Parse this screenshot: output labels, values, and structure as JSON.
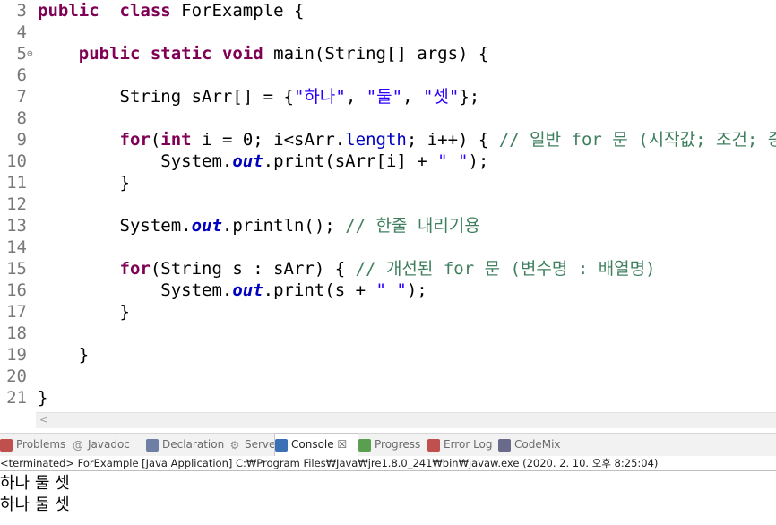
{
  "editor": {
    "lines": [
      {
        "n": "3",
        "parts": [
          [
            "kw",
            "public"
          ],
          [
            "",
            "  "
          ],
          [
            "kw",
            "class"
          ],
          [
            "",
            " ForExample {"
          ]
        ]
      },
      {
        "n": "4",
        "parts": []
      },
      {
        "n": "5",
        "fold": true,
        "parts": [
          [
            "",
            "    "
          ],
          [
            "kw",
            "public"
          ],
          [
            "",
            " "
          ],
          [
            "kw",
            "static"
          ],
          [
            "",
            " "
          ],
          [
            "kw",
            "void"
          ],
          [
            "",
            " main(String[] args) {"
          ]
        ]
      },
      {
        "n": "6",
        "parts": []
      },
      {
        "n": "7",
        "parts": [
          [
            "",
            "        String sArr[] = {"
          ],
          [
            "str",
            "\"하나\""
          ],
          [
            "",
            ", "
          ],
          [
            "str",
            "\"둘\""
          ],
          [
            "",
            ", "
          ],
          [
            "str",
            "\"셋\""
          ],
          [
            "",
            "};"
          ]
        ]
      },
      {
        "n": "8",
        "parts": []
      },
      {
        "n": "9",
        "parts": [
          [
            "",
            "        "
          ],
          [
            "kw",
            "for"
          ],
          [
            "",
            "("
          ],
          [
            "kw",
            "int"
          ],
          [
            "",
            " i = 0; i<sArr."
          ],
          [
            "fld",
            "length"
          ],
          [
            "",
            "; i++) { "
          ],
          [
            "cm",
            "// 일반 for 문 (시작값; 조건; 증감;)"
          ]
        ]
      },
      {
        "n": "10",
        "parts": [
          [
            "",
            "            System."
          ],
          [
            "sfld",
            "out"
          ],
          [
            "",
            ".print(sArr[i] + "
          ],
          [
            "str",
            "\" \""
          ],
          [
            "",
            ");"
          ]
        ]
      },
      {
        "n": "11",
        "parts": [
          [
            "",
            "        }"
          ]
        ]
      },
      {
        "n": "12",
        "parts": []
      },
      {
        "n": "13",
        "parts": [
          [
            "",
            "        System."
          ],
          [
            "sfld",
            "out"
          ],
          [
            "",
            ".println(); "
          ],
          [
            "cm",
            "// 한줄 내리기용"
          ]
        ]
      },
      {
        "n": "14",
        "parts": []
      },
      {
        "n": "15",
        "parts": [
          [
            "",
            "        "
          ],
          [
            "kw",
            "for"
          ],
          [
            "",
            "(String s : sArr) { "
          ],
          [
            "cm",
            "// 개선된 for 문 (변수명 : 배열명)"
          ]
        ]
      },
      {
        "n": "16",
        "parts": [
          [
            "",
            "            System."
          ],
          [
            "sfld",
            "out"
          ],
          [
            "",
            ".print(s + "
          ],
          [
            "str",
            "\" \""
          ],
          [
            "",
            ");"
          ]
        ]
      },
      {
        "n": "17",
        "parts": [
          [
            "",
            "        }"
          ]
        ]
      },
      {
        "n": "18",
        "parts": []
      },
      {
        "n": "19",
        "parts": [
          [
            "",
            "    }"
          ]
        ]
      },
      {
        "n": "20",
        "parts": []
      },
      {
        "n": "21",
        "parts": [
          [
            "",
            "}"
          ]
        ]
      }
    ]
  },
  "tabs": [
    {
      "label": "Problems",
      "icon": "problems-icon",
      "color": "#c0504d"
    },
    {
      "label": "Javadoc",
      "icon": "javadoc-icon",
      "glyph": "@",
      "color": "#8a8a8a"
    },
    {
      "label": "Declaration",
      "icon": "declaration-icon",
      "color": "#6d7fa3"
    },
    {
      "label": "Servers",
      "icon": "servers-icon",
      "glyph": "⚙",
      "color": "#8a8a8a"
    },
    {
      "label": "Console",
      "icon": "console-icon",
      "active": true,
      "color": "#3b6fb6"
    },
    {
      "label": "Progress",
      "icon": "progress-icon",
      "color": "#5a9e4f"
    },
    {
      "label": "Error Log",
      "icon": "error-log-icon",
      "color": "#c0504d"
    },
    {
      "label": "CodeMix",
      "icon": "codemix-icon",
      "color": "#6a6a8a"
    }
  ],
  "console": {
    "close_glyph": "☒",
    "status": "<terminated> ForExample [Java Application] C:₩Program Files₩Java₩jre1.8.0_241₩bin₩javaw.exe (2020. 2. 10. 오후 8:25:04)",
    "output": [
      "하나 둘 셋",
      "하나 둘 셋"
    ]
  },
  "scroll_arrow": "<"
}
